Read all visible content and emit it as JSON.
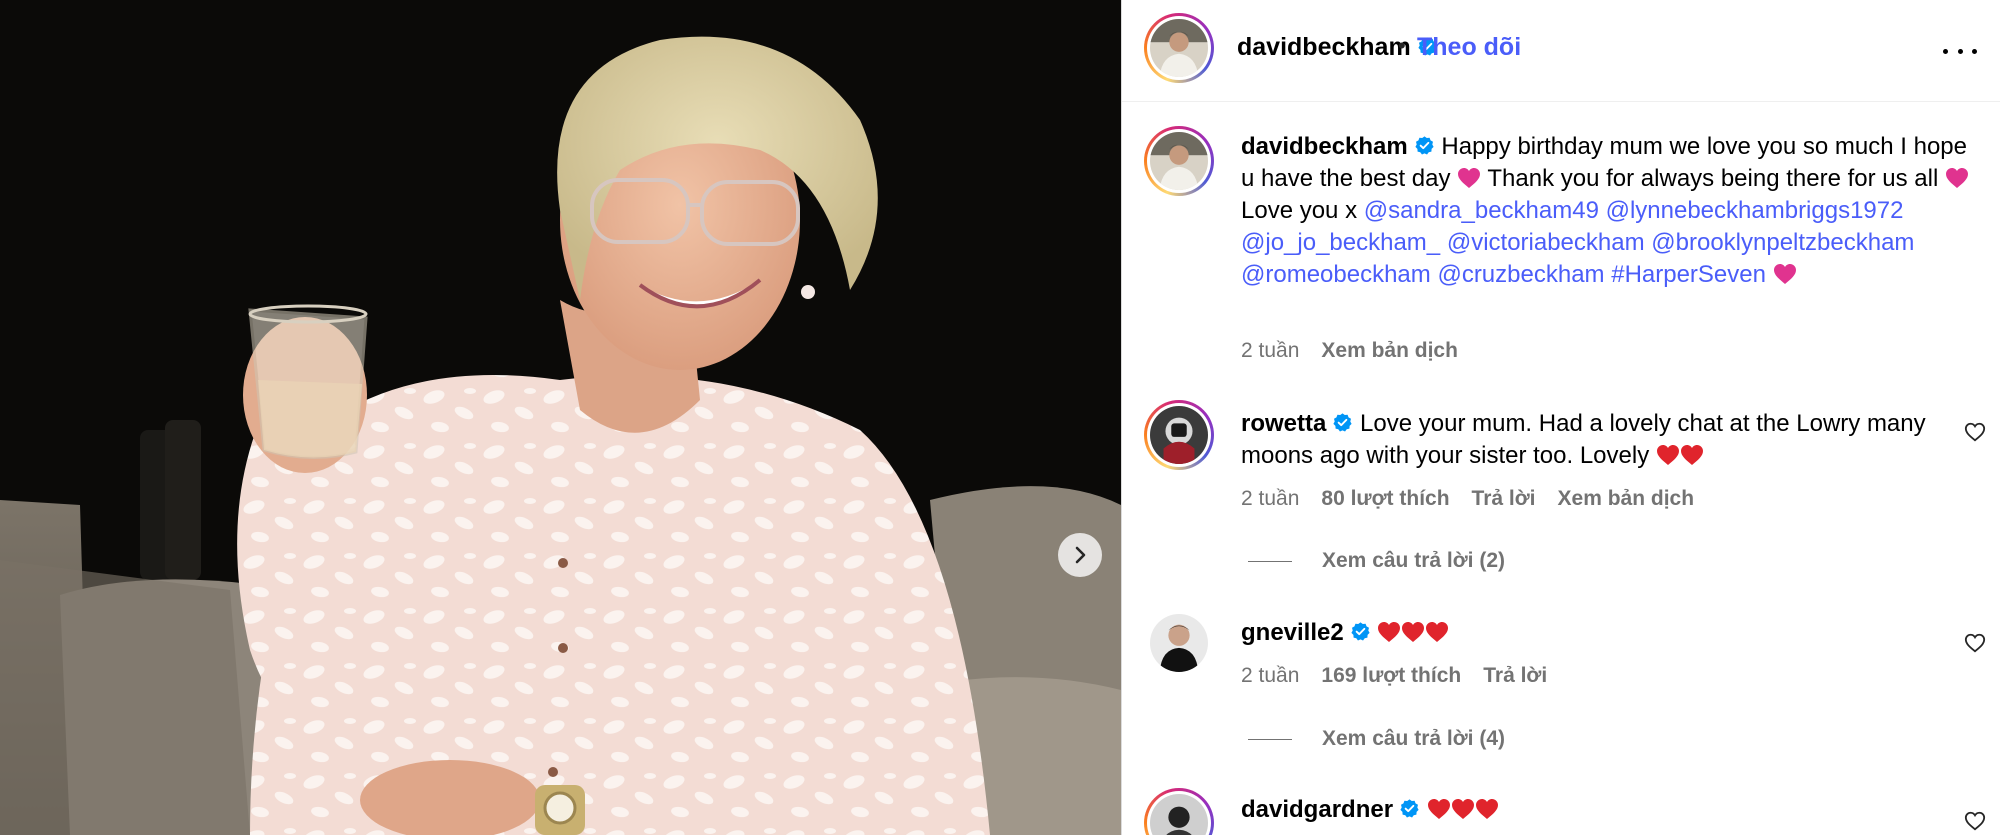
{
  "header": {
    "username": "davidbeckham",
    "separator": "•",
    "follow_label": "Theo dõi",
    "more_icon": "more-horizontal-icon"
  },
  "caption": {
    "username": "davidbeckham",
    "text_1": "Happy birthday mum we love you so much I hope u have the best day",
    "text_2": "Thank you for always being there for us all",
    "text_3": "Love you x",
    "mentions": [
      "@sandra_beckham49",
      "@lynnebeckhambriggs1972",
      "@jo_jo_beckham_",
      "@victoriabeckham",
      "@brooklynpeltzbeckham",
      "@romeobeckham",
      "@cruzbeckham"
    ],
    "hashtag": "#HarperSeven",
    "time": "2 tuần",
    "translate": "Xem bản dịch"
  },
  "comments": [
    {
      "username": "rowetta",
      "text": "Love your mum. Had a lovely chat at the Lowry many moons ago with your sister too. Lovely",
      "time": "2 tuần",
      "likes": "80 lượt thích",
      "reply": "Trả lời",
      "translate": "Xem bản dịch",
      "view_replies": "Xem câu trả lời (2)"
    },
    {
      "username": "gneville2",
      "text": "",
      "time": "2 tuần",
      "likes": "169 lượt thích",
      "reply": "Trả lời",
      "view_replies": "Xem câu trả lời (4)"
    },
    {
      "username": "davidgardner",
      "text": ""
    }
  ],
  "colors": {
    "link": "#4a5df9",
    "muted": "#737373",
    "verified": "#0095f6",
    "pink_heart": "#e0338f",
    "red_heart": "#e0242c"
  }
}
